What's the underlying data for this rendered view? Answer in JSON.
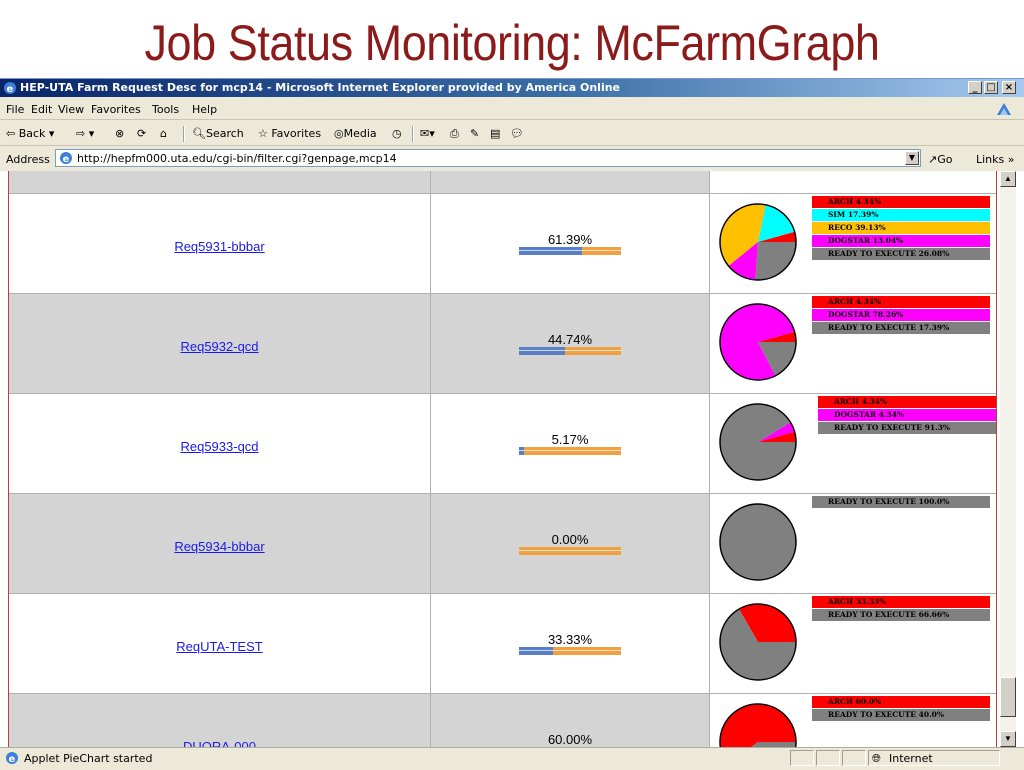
{
  "slide": {
    "title": "Job Status Monitoring: McFarmGraph"
  },
  "window": {
    "title": "HEP-UTA Farm Request Desc for mcp14 - Microsoft Internet Explorer provided by America Online",
    "minimize": "_",
    "maximize": "□",
    "close": "×"
  },
  "menu": [
    "File",
    "Edit",
    "View",
    "Favorites",
    "Tools",
    "Help"
  ],
  "toolbar": {
    "back": "Back",
    "search": "Search",
    "favorites": "Favorites",
    "media": "Media"
  },
  "address": {
    "label": "Address",
    "url": "http://hepfm000.uta.edu/cgi-bin/filter.cgi?genpage,mcp14",
    "go": "Go",
    "links": "Links »"
  },
  "status": {
    "text": "Applet PieChart started",
    "zone": "Internet"
  },
  "colors": {
    "ARCH": "#ff0000",
    "SIM": "#00ffff",
    "RECO": "#ffc000",
    "DOGSTAR": "#ff00ff",
    "READY TO EXECUTE": "#808080",
    "progress_done": "#5b7fc6",
    "progress_remaining": "#f0a040"
  },
  "requests": [
    {
      "name": "Req5931-bbbar",
      "progress_label": "61.39%",
      "progress": 61.39,
      "legend": [
        "ARCH 4.34%",
        "SIM 17.39%",
        "RECO 39.13%",
        "DOGSTAR 13.04%",
        "READY TO EXECUTE 26.08%"
      ]
    },
    {
      "name": "Req5932-qcd",
      "progress_label": "44.74%",
      "progress": 44.74,
      "legend": [
        "ARCH 4.34%",
        "DOGSTAR 78.26%",
        "READY TO EXECUTE 17.39%"
      ]
    },
    {
      "name": "Req5933-qcd",
      "progress_label": "5.17%",
      "progress": 5.17,
      "legend": [
        "ARCH 4.34%",
        "DOGSTAR 4.34%",
        "READY TO EXECUTE 91.3%"
      ]
    },
    {
      "name": "Req5934-bbbar",
      "progress_label": "0.00%",
      "progress": 0,
      "legend": [
        "READY TO EXECUTE 100.0%"
      ]
    },
    {
      "name": "ReqUTA-TEST",
      "progress_label": "33.33%",
      "progress": 33.33,
      "legend": [
        "ARCH 33.33%",
        "READY TO EXECUTE 66.66%"
      ]
    },
    {
      "name": "DUQRA-000",
      "progress_label": "60.00%",
      "progress": 60,
      "legend": [
        "ARCH 60.0%",
        "READY TO EXECUTE 40.0%"
      ]
    }
  ],
  "chart_data": [
    {
      "type": "pie",
      "slices": [
        {
          "label": "ARCH",
          "value": 4.34
        },
        {
          "label": "SIM",
          "value": 17.39
        },
        {
          "label": "RECO",
          "value": 39.13
        },
        {
          "label": "DOGSTAR",
          "value": 13.04
        },
        {
          "label": "READY TO EXECUTE",
          "value": 26.08
        }
      ]
    },
    {
      "type": "pie",
      "slices": [
        {
          "label": "ARCH",
          "value": 4.34
        },
        {
          "label": "DOGSTAR",
          "value": 78.26
        },
        {
          "label": "READY TO EXECUTE",
          "value": 17.39
        }
      ]
    },
    {
      "type": "pie",
      "slices": [
        {
          "label": "ARCH",
          "value": 4.34
        },
        {
          "label": "DOGSTAR",
          "value": 4.34
        },
        {
          "label": "READY TO EXECUTE",
          "value": 91.3
        }
      ]
    },
    {
      "type": "pie",
      "slices": [
        {
          "label": "READY TO EXECUTE",
          "value": 100.0
        }
      ]
    },
    {
      "type": "pie",
      "slices": [
        {
          "label": "ARCH",
          "value": 33.33
        },
        {
          "label": "READY TO EXECUTE",
          "value": 66.66
        }
      ]
    },
    {
      "type": "pie",
      "slices": [
        {
          "label": "ARCH",
          "value": 60.0
        },
        {
          "label": "READY TO EXECUTE",
          "value": 40.0
        }
      ]
    }
  ]
}
